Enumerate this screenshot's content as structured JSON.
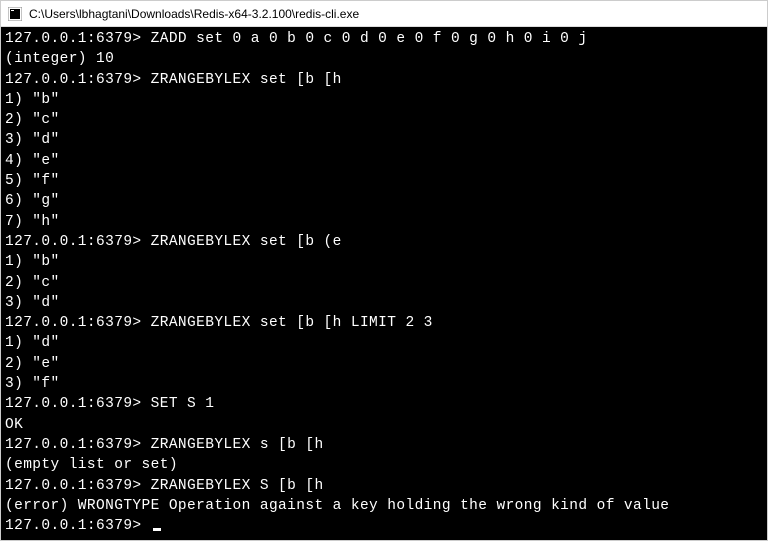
{
  "titlebar": {
    "path": "C:\\Users\\lbhagtani\\Downloads\\Redis-x64-3.2.100\\redis-cli.exe"
  },
  "prompt": "127.0.0.1:6379>",
  "lines": [
    {
      "type": "cmd",
      "text": "ZADD set 0 a 0 b 0 c 0 d 0 e 0 f 0 g 0 h 0 i 0 j"
    },
    {
      "type": "out",
      "text": "(integer) 10"
    },
    {
      "type": "cmd",
      "text": "ZRANGEBYLEX set [b [h"
    },
    {
      "type": "out",
      "text": "1) \"b\""
    },
    {
      "type": "out",
      "text": "2) \"c\""
    },
    {
      "type": "out",
      "text": "3) \"d\""
    },
    {
      "type": "out",
      "text": "4) \"e\""
    },
    {
      "type": "out",
      "text": "5) \"f\""
    },
    {
      "type": "out",
      "text": "6) \"g\""
    },
    {
      "type": "out",
      "text": "7) \"h\""
    },
    {
      "type": "cmd",
      "text": "ZRANGEBYLEX set [b (e"
    },
    {
      "type": "out",
      "text": "1) \"b\""
    },
    {
      "type": "out",
      "text": "2) \"c\""
    },
    {
      "type": "out",
      "text": "3) \"d\""
    },
    {
      "type": "cmd",
      "text": "ZRANGEBYLEX set [b [h LIMIT 2 3"
    },
    {
      "type": "out",
      "text": "1) \"d\""
    },
    {
      "type": "out",
      "text": "2) \"e\""
    },
    {
      "type": "out",
      "text": "3) \"f\""
    },
    {
      "type": "cmd",
      "text": "SET S 1"
    },
    {
      "type": "out",
      "text": "OK"
    },
    {
      "type": "cmd",
      "text": "ZRANGEBYLEX s [b [h"
    },
    {
      "type": "out",
      "text": "(empty list or set)"
    },
    {
      "type": "cmd",
      "text": "ZRANGEBYLEX S [b [h"
    },
    {
      "type": "out",
      "text": "(error) WRONGTYPE Operation against a key holding the wrong kind of value"
    },
    {
      "type": "cmd-cursor",
      "text": ""
    }
  ]
}
